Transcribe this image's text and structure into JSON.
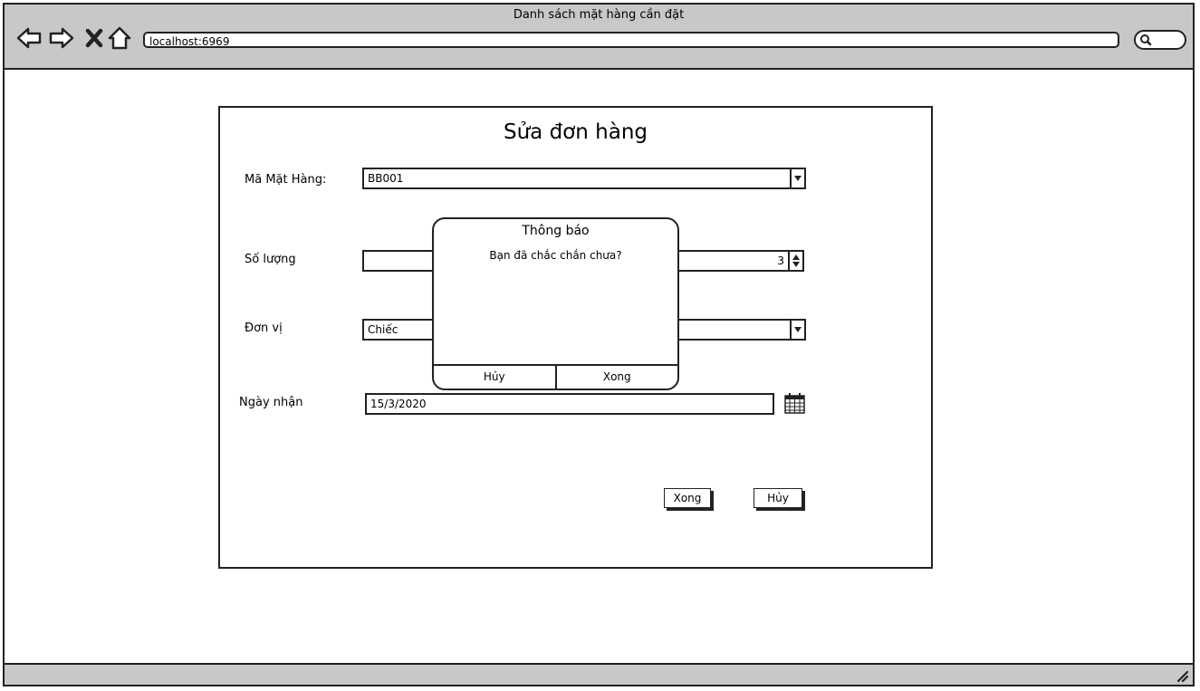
{
  "window": {
    "title": "Danh sách mặt hàng cần đặt"
  },
  "browser": {
    "url": "localhost:6969"
  },
  "form": {
    "title": "Sửa đơn hàng",
    "product_code": {
      "label": "Mã Mặt Hàng:",
      "value": "BB001"
    },
    "quantity": {
      "label": "Số lượng",
      "value": "3"
    },
    "unit": {
      "label": "Đơn vị",
      "value": "Chiếc"
    },
    "date": {
      "label": "Ngày nhận",
      "value": "15/3/2020"
    },
    "done_button": "Xong",
    "cancel_button": "Hủy"
  },
  "dialog": {
    "title": "Thông báo",
    "message": "Bạn đã chắc chắn chưa?",
    "cancel": "Hủy",
    "confirm": "Xong"
  }
}
